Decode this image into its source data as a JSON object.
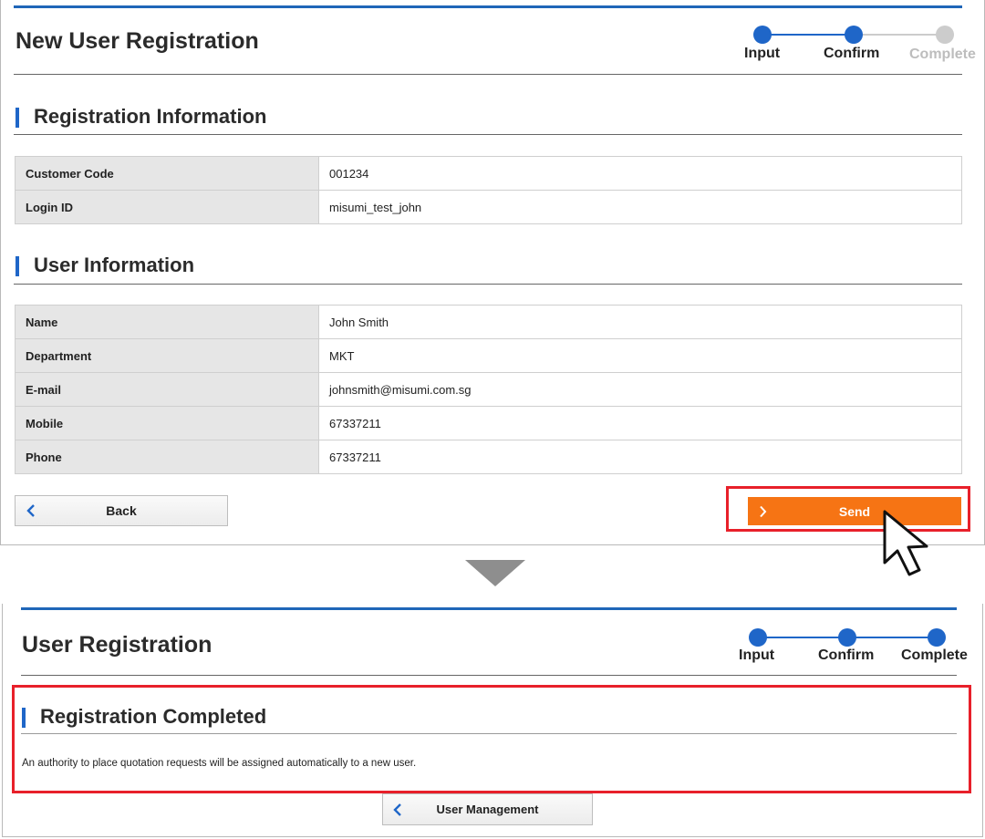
{
  "confirm_panel": {
    "title": "New User Registration",
    "steps": [
      {
        "label": "Input",
        "state": "done"
      },
      {
        "label": "Confirm",
        "state": "current"
      },
      {
        "label": "Complete",
        "state": "pending"
      }
    ],
    "registration_section": {
      "heading": "Registration Information",
      "rows": [
        {
          "label": "Customer Code",
          "value": "001234"
        },
        {
          "label": "Login ID",
          "value": "misumi_test_john"
        }
      ]
    },
    "user_section": {
      "heading": "User Information",
      "rows": [
        {
          "label": "Name",
          "value": "John Smith"
        },
        {
          "label": "Department",
          "value": "MKT"
        },
        {
          "label": "E-mail",
          "value": "johnsmith@misumi.com.sg"
        },
        {
          "label": "Mobile",
          "value": "67337211"
        },
        {
          "label": "Phone",
          "value": "67337211"
        }
      ]
    },
    "back_label": "Back",
    "send_label": "Send"
  },
  "complete_panel": {
    "title": "User Registration",
    "steps": [
      {
        "label": "Input",
        "state": "done"
      },
      {
        "label": "Confirm",
        "state": "done"
      },
      {
        "label": "Complete",
        "state": "done"
      }
    ],
    "heading": "Registration Completed",
    "message": "An authority to place quotation requests will be assigned automatically to a new user.",
    "user_management_label": "User Management"
  },
  "colors": {
    "accent_blue": "#1f66c8",
    "send_orange": "#f67414",
    "highlight_red": "#e8202a",
    "inactive_step": "#cccccc"
  },
  "icons": [
    "chevron-left-icon",
    "chevron-right-icon",
    "mouse-pointer-icon",
    "down-arrow-icon"
  ]
}
